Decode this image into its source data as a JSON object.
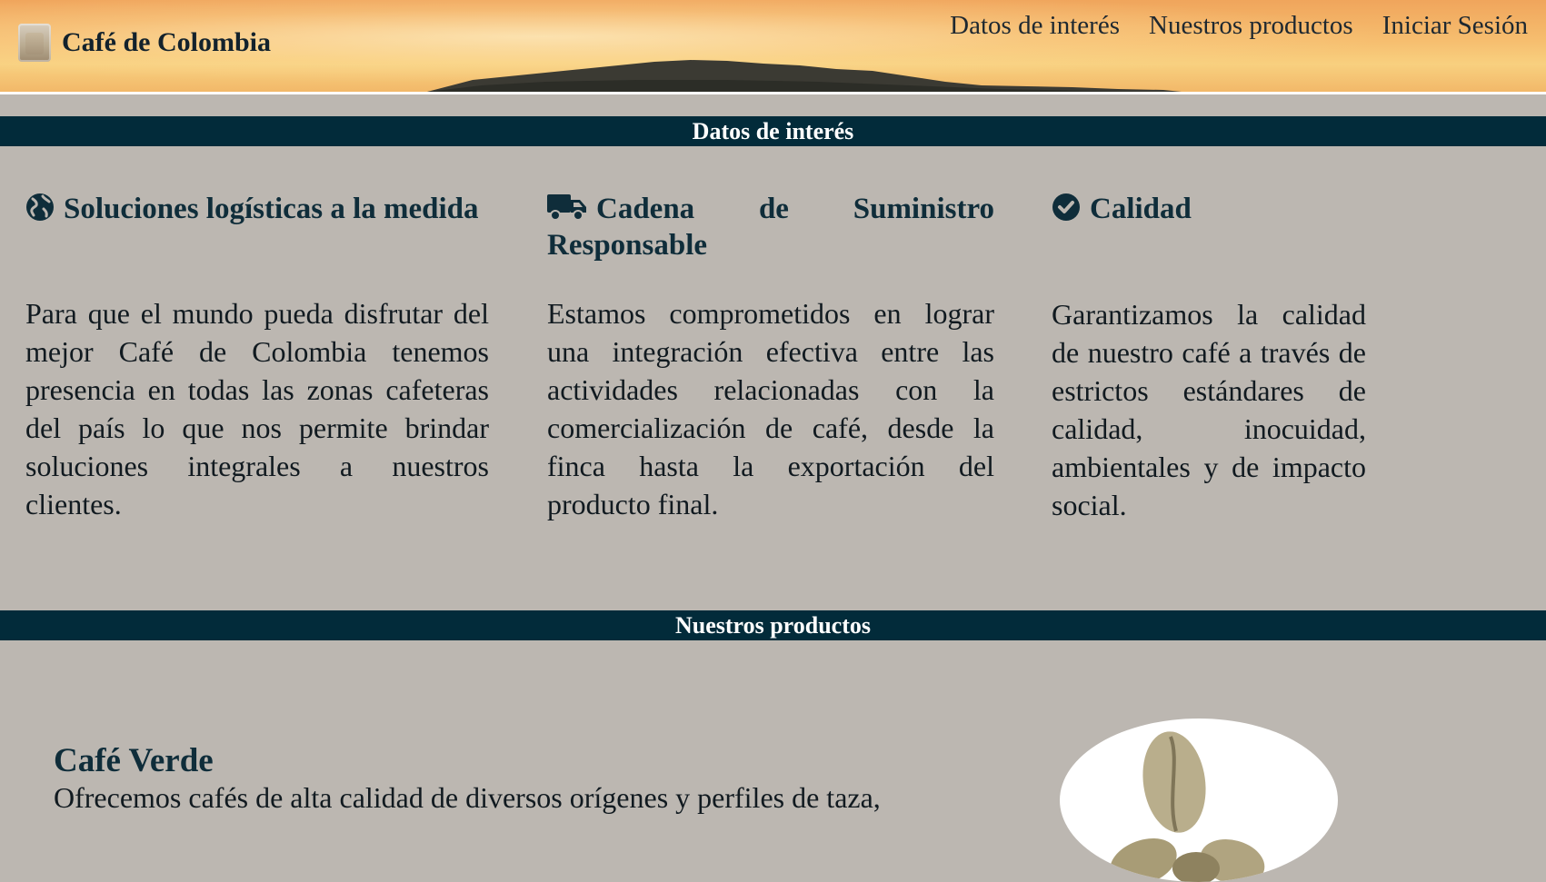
{
  "brand": {
    "name": "Café de Colombia"
  },
  "nav": {
    "items": [
      {
        "label": "Datos de interés"
      },
      {
        "label": "Nuestros productos"
      },
      {
        "label": "Iniciar Sesión"
      }
    ]
  },
  "sections": {
    "datos_title": "Datos de interés",
    "productos_title": "Nuestros productos"
  },
  "features": [
    {
      "icon": "globe-icon",
      "title": "Soluciones logísticas a la medida",
      "text": "Para que el mundo pueda disfrutar del mejor Café de Colombia tenemos presencia en todas las zonas cafeteras del país lo que nos permite brindar soluciones integrales a nuestros clientes."
    },
    {
      "icon": "truck-icon",
      "title": "Cadena de Suministro Responsable",
      "text": "Estamos comprometidos en lograr una integración efectiva entre las actividades relacionadas con la comercialización de café, desde la finca hasta la exportación del producto final."
    },
    {
      "icon": "check-circle-icon",
      "title": "Calidad",
      "text": "Garantizamos la calidad de nuestro café a través de estrictos estándares de calidad, inocuidad, ambientales y de impacto social."
    }
  ],
  "products": [
    {
      "title": "Café Verde",
      "description": "Ofrecemos cafés de alta calidad de diversos orígenes y perfiles de taza,",
      "image": "green-coffee-beans-image"
    }
  ],
  "colors": {
    "page_background": "#bcb7b1",
    "section_bar": "#022b3a",
    "heading": "#0f2d3a",
    "body_text": "#111a20",
    "header_sky": "#f6be6f"
  }
}
